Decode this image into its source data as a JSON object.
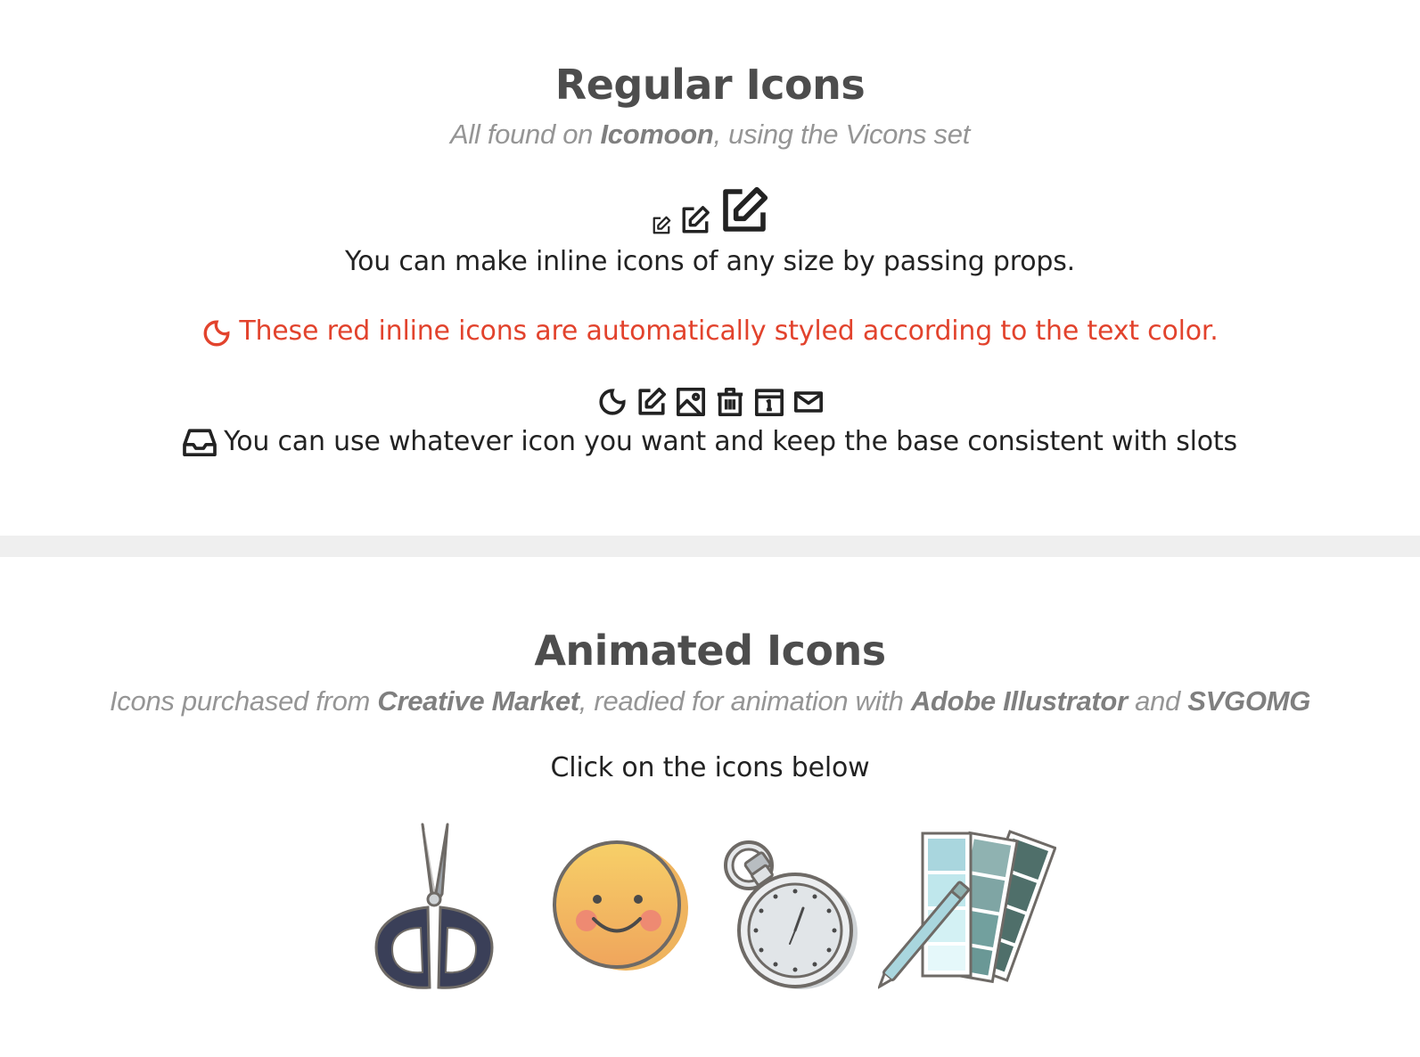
{
  "regular": {
    "title": "Regular Icons",
    "subtitle_prefix": "All found on ",
    "subtitle_source": "Icomoon",
    "subtitle_suffix": ", using the Vicons set",
    "sizes_caption": "You can make inline icons of any size by passing props.",
    "sizes_icons": [
      "edit-icon",
      "edit-icon",
      "edit-icon"
    ],
    "red_caption": "These red inline icons are automatically styled according to the text color.",
    "red_icon": "moon-icon",
    "red_color": "#e2432d",
    "slot_icons": [
      "moon-icon",
      "edit-icon",
      "image-icon",
      "trash-icon",
      "calendar-icon",
      "mail-icon"
    ],
    "slot_caption": "You can use whatever icon you want and keep the base consistent with slots",
    "slot_caption_icon": "inbox-icon"
  },
  "animated": {
    "title": "Animated Icons",
    "subtitle_prefix": "Icons purchased from ",
    "subtitle_source1": "Creative Market",
    "subtitle_mid": ", readied for animation with ",
    "subtitle_source2": "Adobe Illustrator",
    "subtitle_and": " and ",
    "subtitle_source3": "SVGOMG",
    "instruction": "Click on the icons below",
    "icons": [
      "scissors-icon",
      "smiley-icon",
      "stopwatch-icon",
      "swatches-icon"
    ]
  },
  "colors": {
    "heading": "#4d4d4d",
    "subtitle": "#959595",
    "divider": "#efefef",
    "text": "#222222"
  }
}
